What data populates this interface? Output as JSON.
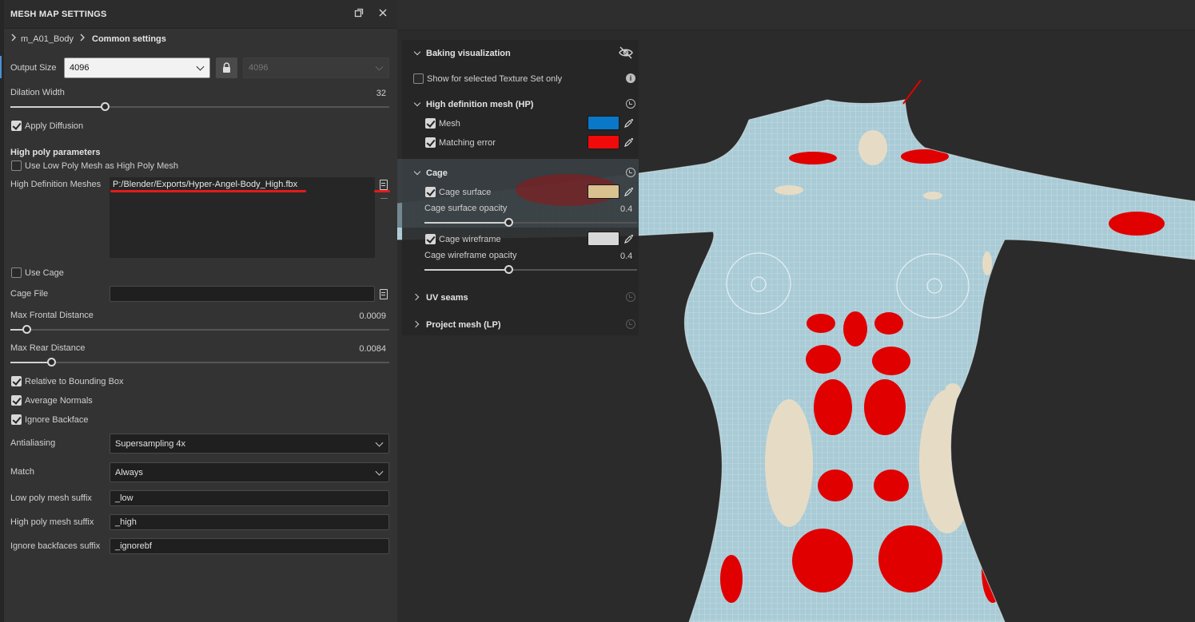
{
  "panel": {
    "title": "MESH MAP SETTINGS",
    "breadcrumb": {
      "item": "m_A01_Body",
      "current": "Common settings"
    }
  },
  "common": {
    "output_size_label": "Output Size",
    "output_size_value": "4096",
    "output_size_linked_value": "4096",
    "dilation_label": "Dilation Width",
    "dilation_value": "32",
    "dilation_fraction": 0.25,
    "apply_diffusion_label": "Apply Diffusion",
    "apply_diffusion_checked": true
  },
  "high_poly": {
    "section_title": "High poly parameters",
    "use_low_as_high_label": "Use Low Poly Mesh as High Poly Mesh",
    "use_low_as_high_checked": false,
    "hd_meshes_label": "High Definition Meshes",
    "hd_meshes_value": "P:/Blender/Exports/Hyper-Angel-Body_High.fbx",
    "use_cage_label": "Use Cage",
    "use_cage_checked": false,
    "cage_file_label": "Cage File",
    "cage_file_value": "",
    "max_frontal_label": "Max Frontal Distance",
    "max_frontal_value": "0.0009",
    "max_frontal_fraction": 0.045,
    "max_rear_label": "Max Rear Distance",
    "max_rear_value": "0.0084",
    "max_rear_fraction": 0.11,
    "relative_bbox_label": "Relative to Bounding Box",
    "relative_bbox_checked": true,
    "average_normals_label": "Average Normals",
    "average_normals_checked": true,
    "ignore_backface_label": "Ignore Backface",
    "ignore_backface_checked": true,
    "antialiasing_label": "Antialiasing",
    "antialiasing_value": "Supersampling 4x",
    "match_label": "Match",
    "match_value": "Always",
    "low_suffix_label": "Low poly mesh suffix",
    "low_suffix_value": "_low",
    "high_suffix_label": "High poly mesh suffix",
    "high_suffix_value": "_high",
    "ignore_bf_suffix_label": "Ignore backfaces suffix",
    "ignore_bf_suffix_value": "_ignorebf"
  },
  "overlay": {
    "baking_vis": {
      "title": "Baking visualization",
      "show_selected_label": "Show for selected Texture Set only",
      "show_selected_checked": false
    },
    "hp": {
      "title": "High definition mesh (HP)",
      "mesh_label": "Mesh",
      "mesh_checked": true,
      "mesh_color": "#0a78c8",
      "error_label": "Matching error",
      "error_checked": true,
      "error_color": "#f00a0a"
    },
    "cage": {
      "title": "Cage",
      "surface_label": "Cage surface",
      "surface_checked": true,
      "surface_color": "#d9c290",
      "surface_opacity_label": "Cage surface opacity",
      "surface_opacity_value": "0.4",
      "surface_opacity_fraction": 0.4,
      "wire_label": "Cage wireframe",
      "wire_checked": true,
      "wire_color": "#d8d8d8",
      "wire_opacity_label": "Cage wireframe opacity",
      "wire_opacity_value": "0.4",
      "wire_opacity_fraction": 0.4
    },
    "uv_seams": {
      "title": "UV seams"
    },
    "project_mesh": {
      "title": "Project mesh (LP)"
    }
  },
  "colors": {
    "mesh_blue": "#a9cbd6",
    "error_red": "#e00000",
    "cage_beige": "#e6dcc6"
  }
}
